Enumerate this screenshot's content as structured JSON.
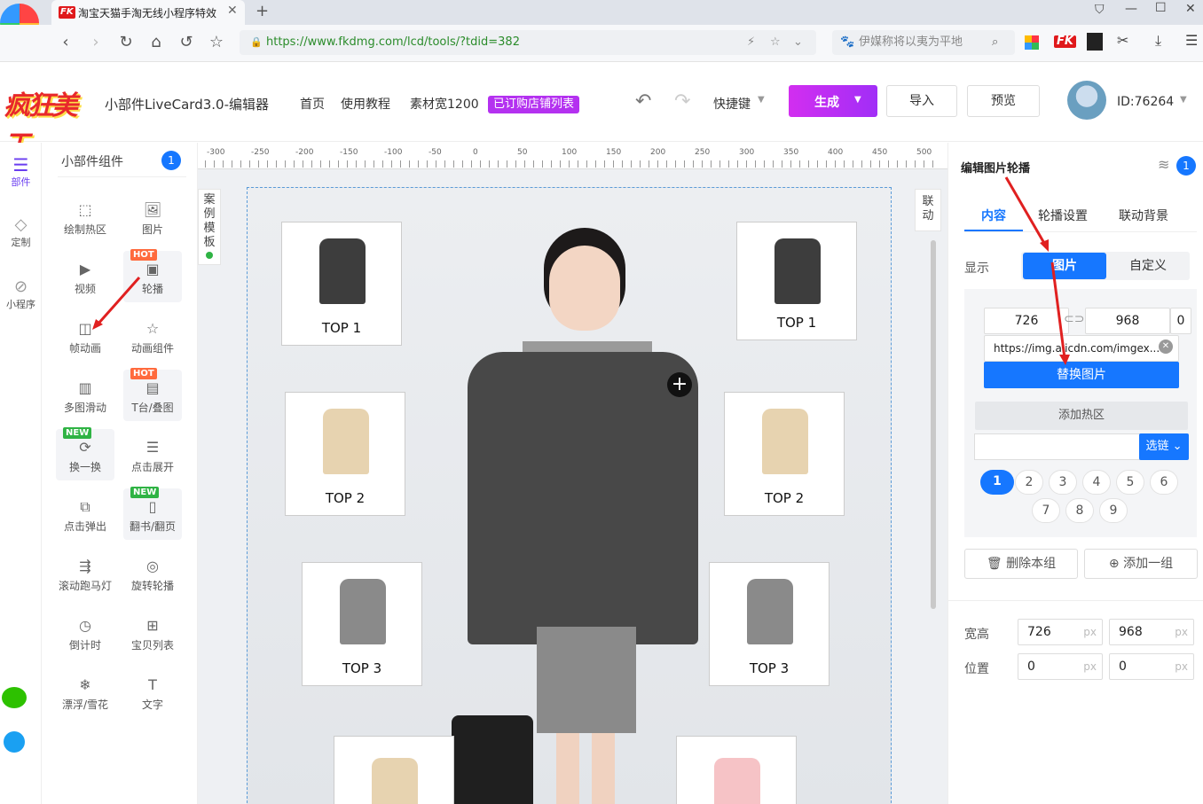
{
  "browser": {
    "tab_title": "淘宝天猫手淘无线小程序特效",
    "fk_logo": "FK",
    "url": "https://www.fkdmg.com/lcd/tools/?tdid=382",
    "search_placeholder": "伊媒称将以夷为平地"
  },
  "header": {
    "app_title": "小部件LiveCard3.0-编辑器",
    "nav": [
      "首页",
      "使用教程",
      "素材宽1200"
    ],
    "shop_list": "已订购店铺列表",
    "shortcut": "快捷键",
    "generate": "生成",
    "import": "导入",
    "preview": "预览",
    "user_id": "ID:76264"
  },
  "rail": [
    {
      "label": "部件",
      "icon": "layers-icon"
    },
    {
      "label": "定制",
      "icon": "diamond-icon"
    },
    {
      "label": "小程序",
      "icon": "miniprogram-icon"
    }
  ],
  "panel": {
    "title": "小部件组件",
    "count": "1",
    "components": [
      {
        "label": "绘制热区",
        "icon": "hotspot-icon",
        "badge": ""
      },
      {
        "label": "图片",
        "icon": "image-icon",
        "badge": ""
      },
      {
        "label": "视频",
        "icon": "video-icon",
        "badge": ""
      },
      {
        "label": "轮播",
        "icon": "carousel-icon",
        "badge": "HOT"
      },
      {
        "label": "帧动画",
        "icon": "gif-icon",
        "badge": ""
      },
      {
        "label": "动画组件",
        "icon": "star-icon",
        "badge": ""
      },
      {
        "label": "多图滑动",
        "icon": "slide-icon",
        "badge": ""
      },
      {
        "label": "T台/叠图",
        "icon": "stack-icon",
        "badge": "HOT"
      },
      {
        "label": "换一换",
        "icon": "refresh-icon",
        "badge": "NEW"
      },
      {
        "label": "点击展开",
        "icon": "expand-icon",
        "badge": ""
      },
      {
        "label": "点击弹出",
        "icon": "popup-icon",
        "badge": ""
      },
      {
        "label": "翻书/翻页",
        "icon": "book-icon",
        "badge": "NEW"
      },
      {
        "label": "滚动跑马灯",
        "icon": "marquee-icon",
        "badge": ""
      },
      {
        "label": "旋转轮播",
        "icon": "rotate-icon",
        "badge": ""
      },
      {
        "label": "倒计时",
        "icon": "clock-icon",
        "badge": ""
      },
      {
        "label": "宝贝列表",
        "icon": "grid-icon",
        "badge": ""
      },
      {
        "label": "漂浮/雪花",
        "icon": "snowflake-icon",
        "badge": ""
      },
      {
        "label": "文字",
        "icon": "text-icon",
        "badge": ""
      }
    ]
  },
  "canvas": {
    "ruler": [
      "-300",
      "-250",
      "-200",
      "-150",
      "-100",
      "-50",
      "0",
      "50",
      "100",
      "150",
      "200",
      "250",
      "300",
      "350",
      "400",
      "450",
      "500"
    ],
    "case_template": [
      "案",
      "例",
      "模",
      "板"
    ],
    "linkage": [
      "联",
      "动"
    ],
    "products": [
      "TOP 1",
      "TOP 1",
      "TOP 2",
      "TOP 2",
      "TOP 3",
      "TOP 3"
    ]
  },
  "right": {
    "title": "编辑图片轮播",
    "count": "1",
    "tabs": [
      "内容",
      "轮播设置",
      "联动背景"
    ],
    "display_label": "显示",
    "display_opts": [
      "图片",
      "自定义"
    ],
    "width": "726",
    "height": "968",
    "extra": "0",
    "img_url": "https://img.alicdn.com/imgex...",
    "replace": "替换图片",
    "add_hot": "添加热区",
    "select_link": "选链",
    "pages_row1": [
      "1",
      "2",
      "3",
      "4",
      "5",
      "6"
    ],
    "pages_row2": [
      "7",
      "8",
      "9"
    ],
    "del_group": "删除本组",
    "add_group": "添加一组",
    "size_label": "宽高",
    "pos_label": "位置",
    "w_val": "726",
    "h_val": "968",
    "x_val": "0",
    "y_val": "0",
    "unit": "px"
  },
  "colors": {
    "primary": "#1677ff",
    "accent": "#b431f0",
    "hot": "#ff6a3d",
    "new": "#2fb344"
  }
}
